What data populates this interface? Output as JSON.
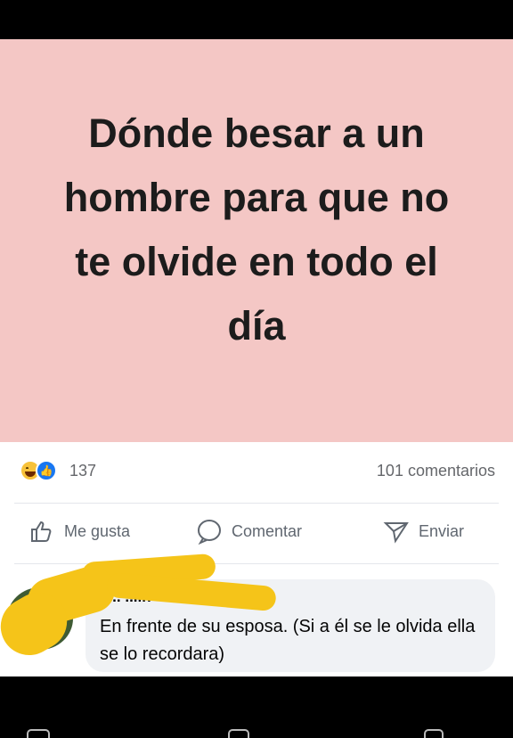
{
  "post": {
    "image_text": "Dónde besar a un hombre para que no te olvide en todo el día",
    "background_color": "#f4c7c5"
  },
  "reactions": {
    "icons": [
      "haha-icon",
      "like-icon"
    ],
    "count": "137",
    "comments_count": "101 comentarios"
  },
  "actions": {
    "like_label": "Me gusta",
    "comment_label": "Comentar",
    "share_label": "Enviar"
  },
  "comment": {
    "author": "J... ...in",
    "text": "En frente de su esposa. (Si a él se le olvida ella se lo recordara)"
  },
  "colors": {
    "accent": "#1877f2",
    "redaction": "#f5c419"
  }
}
